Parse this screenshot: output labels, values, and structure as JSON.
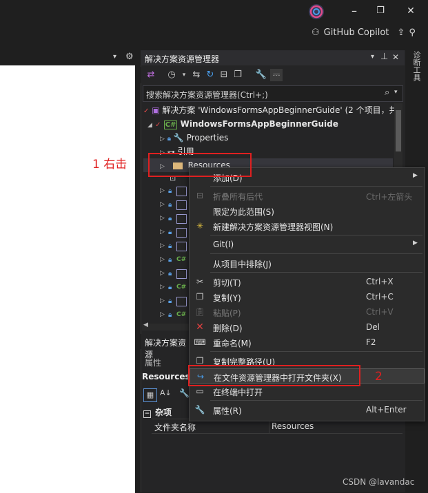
{
  "titlebar": {
    "copilot_label": "GitHub Copilot",
    "minimize": "–",
    "restore": "❐",
    "close": "✕"
  },
  "solution_explorer": {
    "title": "解决方案资源管理器",
    "pin": "ᗊ",
    "close": "✕",
    "search_placeholder": "搜索解决方案资源管理器(Ctrl+;)",
    "tab_label": "解决方案资源",
    "tree": {
      "solution": "解决方案 'WindowsFormsAppBeginnerGuide' (2 个项目，共",
      "project": "WindowsFormsAppBeginnerGuide",
      "properties": "Properties",
      "references": "引用",
      "resources": "Resources"
    }
  },
  "right_tab": "诊断工具",
  "properties": {
    "header": "属性",
    "object": "Resources",
    "category": "杂项",
    "row_name": "文件夹名称",
    "row_value": "Resources"
  },
  "context_menu": {
    "items": [
      {
        "label": "添加(D)",
        "shortcut": "",
        "submenu": true,
        "disabled": false
      },
      {
        "label": "折叠所有后代",
        "shortcut": "Ctrl+左箭头",
        "submenu": false,
        "disabled": true
      },
      {
        "label": "限定为此范围(S)",
        "shortcut": "",
        "submenu": false,
        "disabled": false
      },
      {
        "label": "新建解决方案资源管理器视图(N)",
        "shortcut": "",
        "submenu": false,
        "disabled": false
      },
      {
        "label": "Git(I)",
        "shortcut": "",
        "submenu": true,
        "disabled": false
      },
      {
        "label": "从项目中排除(J)",
        "shortcut": "",
        "submenu": false,
        "disabled": false
      },
      {
        "label": "剪切(T)",
        "shortcut": "Ctrl+X",
        "submenu": false,
        "disabled": false
      },
      {
        "label": "复制(Y)",
        "shortcut": "Ctrl+C",
        "submenu": false,
        "disabled": false
      },
      {
        "label": "粘贴(P)",
        "shortcut": "Ctrl+V",
        "submenu": false,
        "disabled": true
      },
      {
        "label": "删除(D)",
        "shortcut": "Del",
        "submenu": false,
        "disabled": false
      },
      {
        "label": "重命名(M)",
        "shortcut": "F2",
        "submenu": false,
        "disabled": false
      },
      {
        "label": "复制完整路径(U)",
        "shortcut": "",
        "submenu": false,
        "disabled": false
      },
      {
        "label": "在文件资源管理器中打开文件夹(X)",
        "shortcut": "",
        "submenu": false,
        "disabled": false
      },
      {
        "label": "在终端中打开",
        "shortcut": "",
        "submenu": false,
        "disabled": false
      },
      {
        "label": "属性(R)",
        "shortcut": "Alt+Enter",
        "submenu": false,
        "disabled": false
      }
    ]
  },
  "annotations": {
    "step1": "1 右击",
    "step2": "2"
  },
  "watermark": "CSDN @lavandac",
  "colors": {
    "accent_red": "#e02020",
    "cs_green": "#6ab04c",
    "lock_blue": "#5aa0e6",
    "folder_yellow": "#dcb67a"
  }
}
